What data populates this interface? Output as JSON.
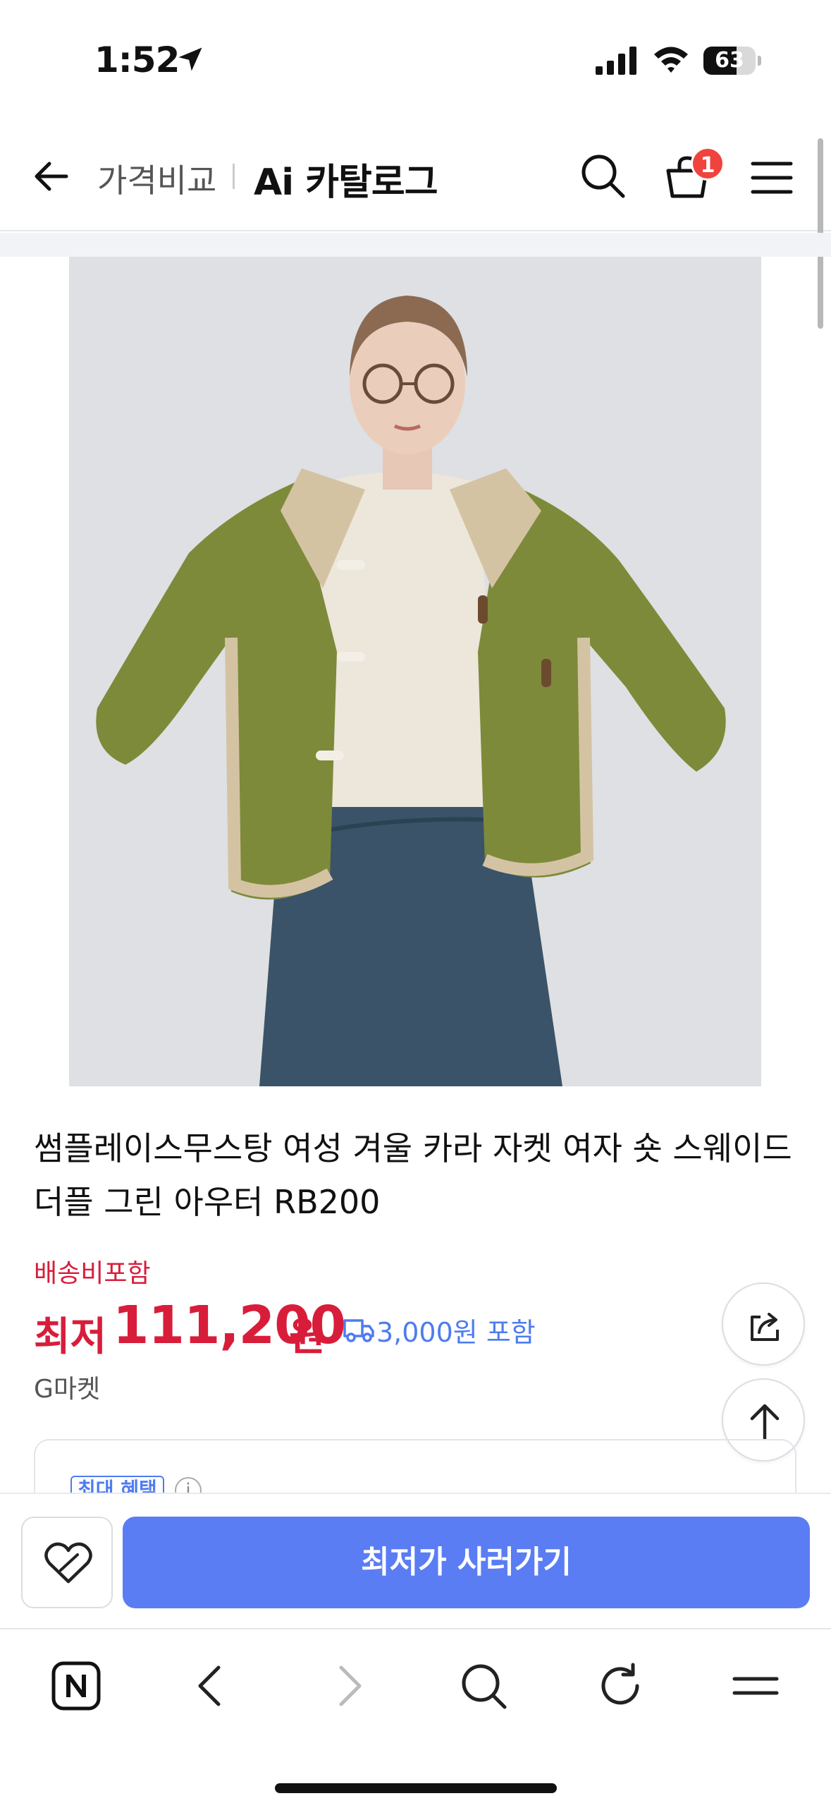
{
  "status_bar": {
    "time": "1:52",
    "battery": "63",
    "battery_level": 0.63
  },
  "header": {
    "breadcrumb_price": "가격비교",
    "breadcrumb_catalog": "Ai 카탈로그",
    "cart_count": "1"
  },
  "product": {
    "title": "썸플레이스무스탕 여성 겨울 카라 자켓 여자 숏 스웨이드 더플 그린 아우터 RB200",
    "shipping_label": "배송비포함",
    "price_prefix": "최저",
    "price": "111,200",
    "price_unit": "원",
    "shipping_fee": "3,000원 포함",
    "seller": "G마켓"
  },
  "benefit": {
    "tag": "최대 혜택",
    "info": "i"
  },
  "actions": {
    "buy_label": "최저가 사러가기"
  },
  "colors": {
    "price_red": "#d81d3b",
    "accent_blue": "#5a7df4",
    "link_blue": "#4e7cf0",
    "badge_red": "#f0433d"
  },
  "icons": [
    "location-arrow-icon",
    "signal-icon",
    "wifi-icon",
    "back-arrow-icon",
    "search-icon",
    "cart-icon",
    "menu-icon",
    "truck-icon",
    "share-icon",
    "arrow-up-icon",
    "heart-icon",
    "naver-icon",
    "chevron-left-icon",
    "chevron-right-icon",
    "refresh-icon"
  ]
}
